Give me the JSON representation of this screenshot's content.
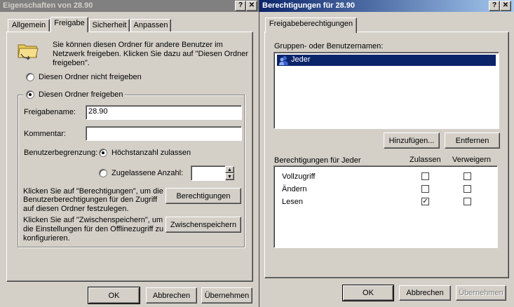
{
  "props_window": {
    "title": "Eigenschaften von 28.90",
    "help_btn": "?",
    "close_btn": "✕",
    "tabs": [
      {
        "label": "Allgemein"
      },
      {
        "label": "Freigabe"
      },
      {
        "label": "Sicherheit"
      },
      {
        "label": "Anpassen"
      }
    ],
    "intro_text_1": "Sie können diesen Ordner für andere Benutzer im",
    "intro_text_2": "Netzwerk freigeben. Klicken Sie dazu auf \"Diesen Ordner",
    "intro_text_3": "freigeben\".",
    "radio_not_shared": "Diesen Ordner nicht freigeben",
    "radio_shared": "Diesen Ordner freigeben",
    "share_name_label": "Freigabename:",
    "share_name_value": "28.90",
    "comment_label": "Kommentar:",
    "comment_value": "",
    "user_limit_label": "Benutzerbegrenzung:",
    "max_allowed": "Höchstanzahl zulassen",
    "allowed_count": "Zugelassene Anzahl:",
    "perm_text_1": "Klicken Sie auf \"Berechtigungen\", um die",
    "perm_text_2": "Benutzerberechtigungen für den Zugriff",
    "perm_text_3": "auf diesen Ordner festzulegen.",
    "perm_button": "Berechtigungen",
    "cache_text_1": "Klicken Sie auf \"Zwischenspeichern\", um",
    "cache_text_2": "die Einstellungen für den Offlinezugriff zu",
    "cache_text_3": "konfigurieren.",
    "cache_button": "Zwischenspeichern",
    "ok": "OK",
    "cancel": "Abbrechen",
    "apply": "Übernehmen"
  },
  "perm_window": {
    "title": "Berechtigungen für 28.90",
    "help_btn": "?",
    "close_btn": "✕",
    "tab": "Freigabeberechtigungen",
    "groups_label": "Gruppen- oder Benutzernamen:",
    "users": [
      {
        "name": "Jeder",
        "selected": true
      }
    ],
    "add_button": "Hinzufügen...",
    "remove_button": "Entfernen",
    "perms_for": "Berechtigungen für Jeder",
    "allow_header": "Zulassen",
    "deny_header": "Verweigern",
    "permissions": [
      {
        "name": "Vollzugriff",
        "allow": false,
        "deny": false
      },
      {
        "name": "Ändern",
        "allow": false,
        "deny": false
      },
      {
        "name": "Lesen",
        "allow": true,
        "deny": false
      }
    ],
    "ok": "OK",
    "cancel": "Abbrechen",
    "apply": "Übernehmen"
  }
}
